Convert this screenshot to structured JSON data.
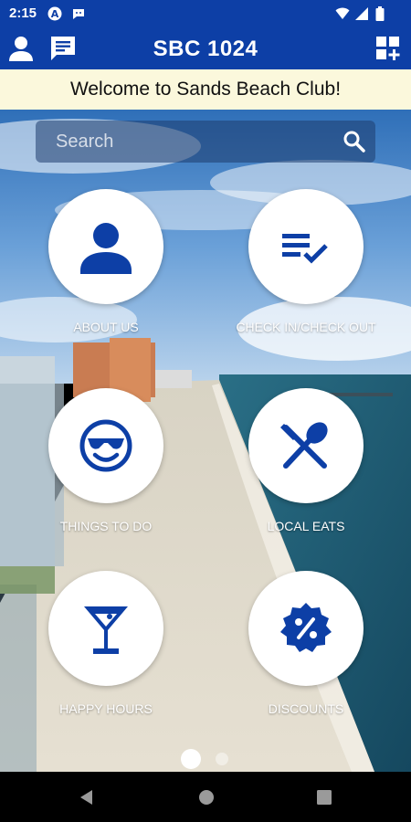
{
  "status_bar": {
    "time": "2:15"
  },
  "app_bar": {
    "title": "SBC 1024"
  },
  "welcome": {
    "text": "Welcome to Sands Beach Club!"
  },
  "search": {
    "placeholder": "Search"
  },
  "tiles": [
    {
      "label": "ABOUT US",
      "icon": "person-icon"
    },
    {
      "label": "CHECK IN/CHECK OUT",
      "icon": "checklist-icon"
    },
    {
      "label": "THINGS TO DO",
      "icon": "sunglasses-face-icon"
    },
    {
      "label": "LOCAL EATS",
      "icon": "fork-spoon-icon"
    },
    {
      "label": "HAPPY HOURS",
      "icon": "martini-icon"
    },
    {
      "label": "DISCOUNTS",
      "icon": "discount-badge-icon"
    }
  ],
  "pager": {
    "page": 1,
    "pages": 2
  },
  "colors": {
    "brand": "#0d3fa6",
    "banner": "#fbf8dc",
    "icon": "#0d3fa6"
  }
}
